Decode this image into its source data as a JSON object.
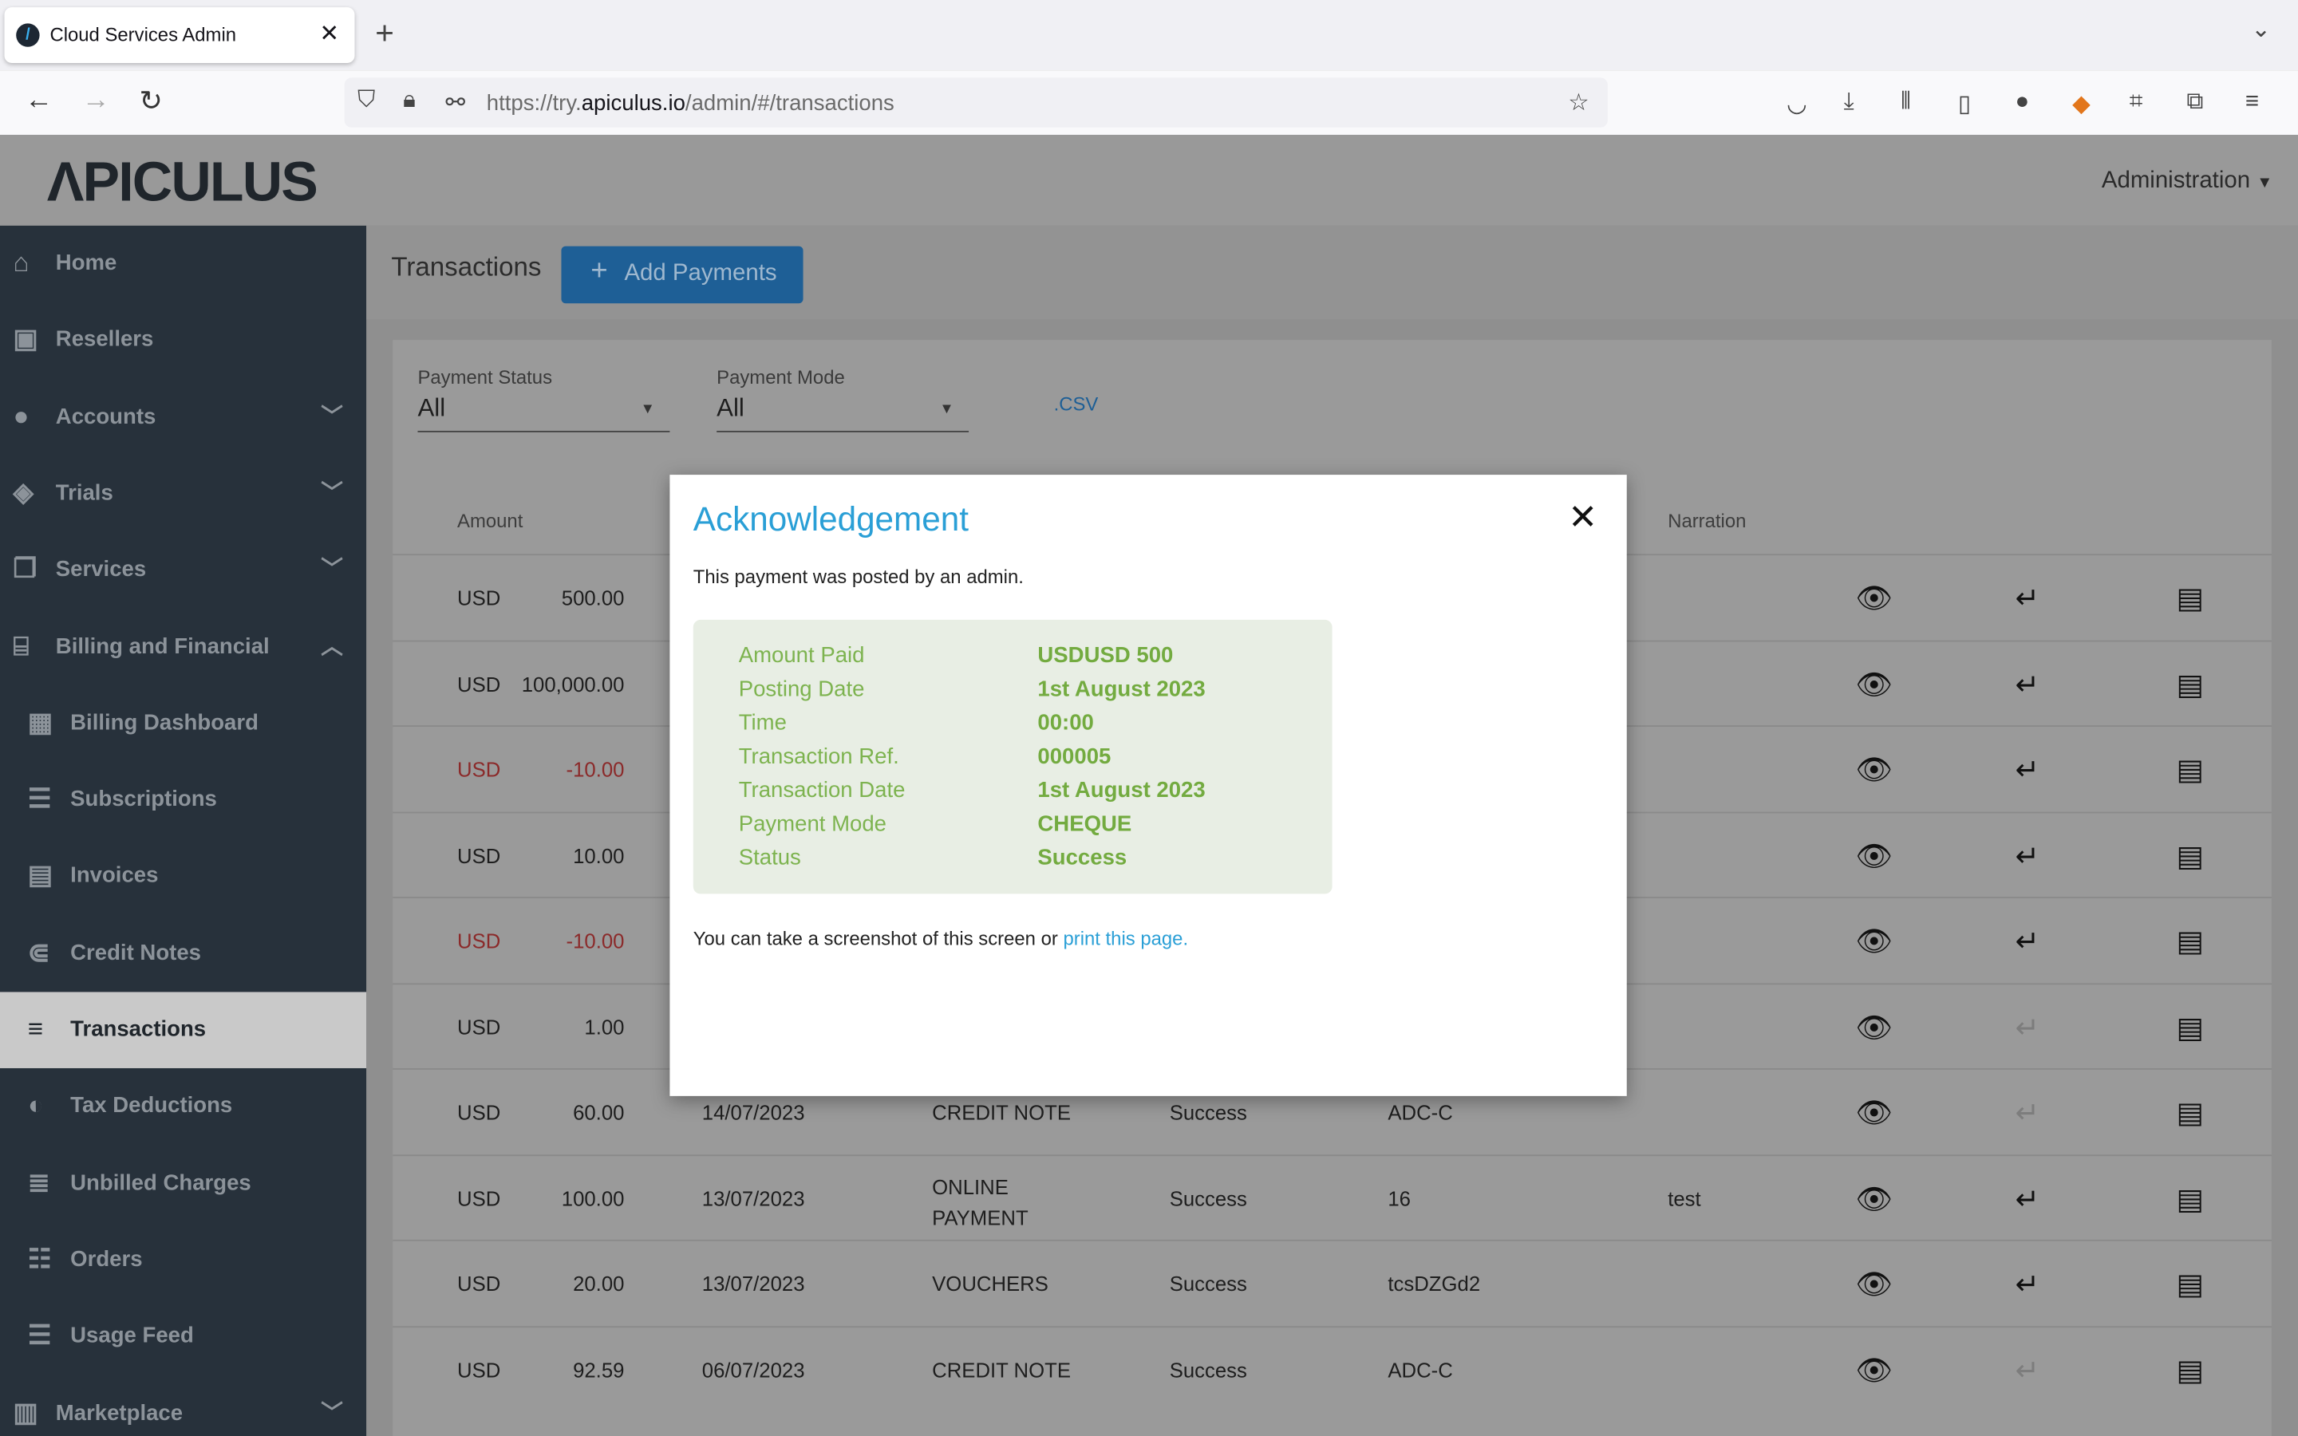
{
  "browser": {
    "tab_title": "Cloud Services Admin",
    "url_prefix": "https://try.",
    "url_domain": "apiculus.io",
    "url_path": "/admin/#/transactions"
  },
  "header": {
    "logo": "ΛPICULUS",
    "menu": "Administration"
  },
  "sidebar": {
    "items": [
      {
        "label": "Home",
        "icon": "home-icon",
        "sub": false
      },
      {
        "label": "Resellers",
        "icon": "reseller-icon",
        "sub": false
      },
      {
        "label": "Accounts",
        "icon": "user-icon",
        "sub": false,
        "chevron": "down"
      },
      {
        "label": "Trials",
        "icon": "tag-icon",
        "sub": false,
        "chevron": "down"
      },
      {
        "label": "Services",
        "icon": "services-icon",
        "sub": false,
        "chevron": "down"
      },
      {
        "label": "Billing and Financial",
        "icon": "bank-icon",
        "sub": false,
        "chevron": "up"
      },
      {
        "label": "Billing Dashboard",
        "icon": "dashboard-icon",
        "sub": true
      },
      {
        "label": "Subscriptions",
        "icon": "list-icon",
        "sub": true
      },
      {
        "label": "Invoices",
        "icon": "invoice-icon",
        "sub": true
      },
      {
        "label": "Credit Notes",
        "icon": "credit-note-icon",
        "sub": true
      },
      {
        "label": "Transactions",
        "icon": "menu-icon",
        "sub": true,
        "active": true
      },
      {
        "label": "Tax Deductions",
        "icon": "tax-icon",
        "sub": true
      },
      {
        "label": "Unbilled Charges",
        "icon": "lines-icon",
        "sub": true
      },
      {
        "label": "Orders",
        "icon": "orders-icon",
        "sub": true
      },
      {
        "label": "Usage Feed",
        "icon": "feed-icon",
        "sub": true
      },
      {
        "label": "Marketplace",
        "icon": "store-icon",
        "sub": false,
        "chevron": "down"
      }
    ]
  },
  "page": {
    "title": "Transactions",
    "add_button": "Add Payments",
    "csv": ".CSV"
  },
  "filters": {
    "payment_status": {
      "label": "Payment Status",
      "value": "All"
    },
    "payment_mode": {
      "label": "Payment Mode",
      "value": "All"
    }
  },
  "table": {
    "headers": {
      "amount": "Amount",
      "narration": "Narration"
    },
    "rows": [
      {
        "cur": "USD",
        "amt": "500.00",
        "date": "",
        "mode": "",
        "status": "",
        "ref": "",
        "narr": "",
        "neg": false,
        "ret_dim": false
      },
      {
        "cur": "USD",
        "amt": "100,000.00",
        "date": "",
        "mode": "",
        "status": "",
        "ref": "",
        "narr": "",
        "neg": false,
        "ret_dim": false
      },
      {
        "cur": "USD",
        "amt": "-10.00",
        "date": "",
        "mode": "",
        "status": "",
        "ref": "",
        "narr": "",
        "neg": true,
        "ret_dim": false
      },
      {
        "cur": "USD",
        "amt": "10.00",
        "date": "",
        "mode": "",
        "status": "",
        "ref": "",
        "narr": "",
        "neg": false,
        "ret_dim": false
      },
      {
        "cur": "USD",
        "amt": "-10.00",
        "date": "",
        "mode": "",
        "status": "",
        "ref": "",
        "narr": "",
        "neg": true,
        "ret_dim": false
      },
      {
        "cur": "USD",
        "amt": "1.00",
        "date": "",
        "mode": "",
        "status": "",
        "ref": "",
        "narr": "",
        "neg": false,
        "ret_dim": true
      },
      {
        "cur": "USD",
        "amt": "60.00",
        "date": "14/07/2023",
        "mode": "CREDIT NOTE",
        "status": "Success",
        "ref": "ADC-C",
        "narr": "",
        "neg": false,
        "ret_dim": true
      },
      {
        "cur": "USD",
        "amt": "100.00",
        "date": "13/07/2023",
        "mode": "ONLINE PAYMENT",
        "status": "Success",
        "ref": "16",
        "narr": "test",
        "neg": false,
        "ret_dim": false
      },
      {
        "cur": "USD",
        "amt": "20.00",
        "date": "13/07/2023",
        "mode": "VOUCHERS",
        "status": "Success",
        "ref": "tcsDZGd2",
        "narr": "",
        "neg": false,
        "ret_dim": false
      },
      {
        "cur": "USD",
        "amt": "92.59",
        "date": "06/07/2023",
        "mode": "CREDIT NOTE",
        "status": "Success",
        "ref": "ADC-C",
        "narr": "",
        "neg": false,
        "ret_dim": true
      }
    ]
  },
  "modal": {
    "title": "Acknowledgement",
    "description": "This payment was posted by an admin.",
    "details": [
      {
        "k": "Amount Paid",
        "v": "USDUSD 500"
      },
      {
        "k": "Posting Date",
        "v": "1st August 2023"
      },
      {
        "k": "Time",
        "v": "00:00"
      },
      {
        "k": "Transaction Ref.",
        "v": "000005"
      },
      {
        "k": "Transaction Date",
        "v": "1st August 2023"
      },
      {
        "k": "Payment Mode",
        "v": "CHEQUE"
      },
      {
        "k": "Status",
        "v": "Success"
      }
    ],
    "footer_text": "You can take a screenshot of this screen or ",
    "footer_link": "print this page."
  }
}
